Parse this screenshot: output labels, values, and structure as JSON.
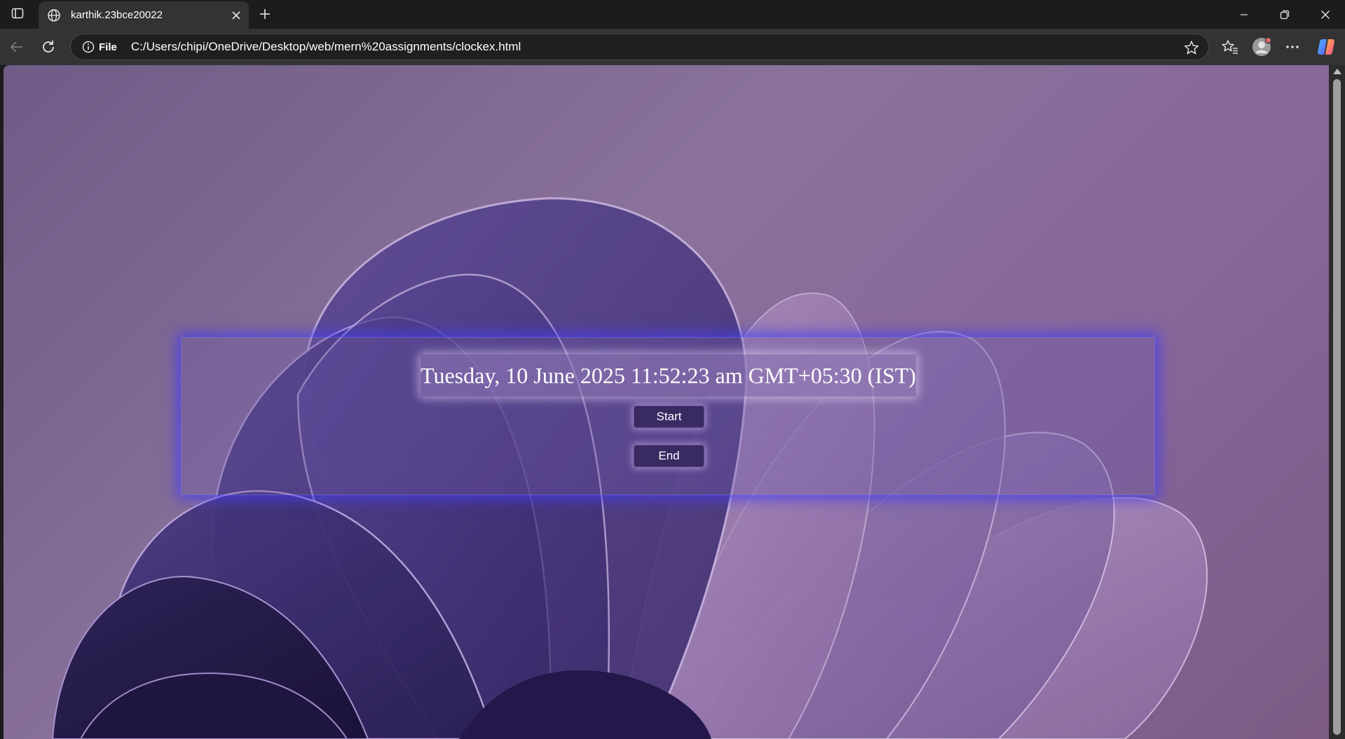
{
  "browser": {
    "tab": {
      "title": "karthik.23bce20022",
      "favicon": "globe-icon"
    },
    "address_bar": {
      "site_info_label": "File",
      "url": "C:/Users/chipi/OneDrive/Desktop/web/mern%20assignments/clockex.html"
    },
    "icons": {
      "tab_actions": "tab-actions-icon",
      "close_tab": "close-icon",
      "new_tab": "plus-icon",
      "back": "back-arrow-icon",
      "refresh": "refresh-icon",
      "favorite": "star-icon",
      "favorites_hub": "favorites-icon",
      "profile": "profile-avatar-icon",
      "more": "more-icon",
      "copilot": "copilot-icon",
      "minimize": "minimize-icon",
      "restore": "restore-icon",
      "close_window": "close-icon"
    }
  },
  "page": {
    "clock_text": "Tuesday, 10 June 2025 11:52:23 am GMT+05:30 (IST)",
    "start_label": "Start",
    "end_label": "End"
  },
  "colors": {
    "panel_glow": "#4b3cf0",
    "button_bg": "#3a2a62",
    "background": "#87679a"
  }
}
